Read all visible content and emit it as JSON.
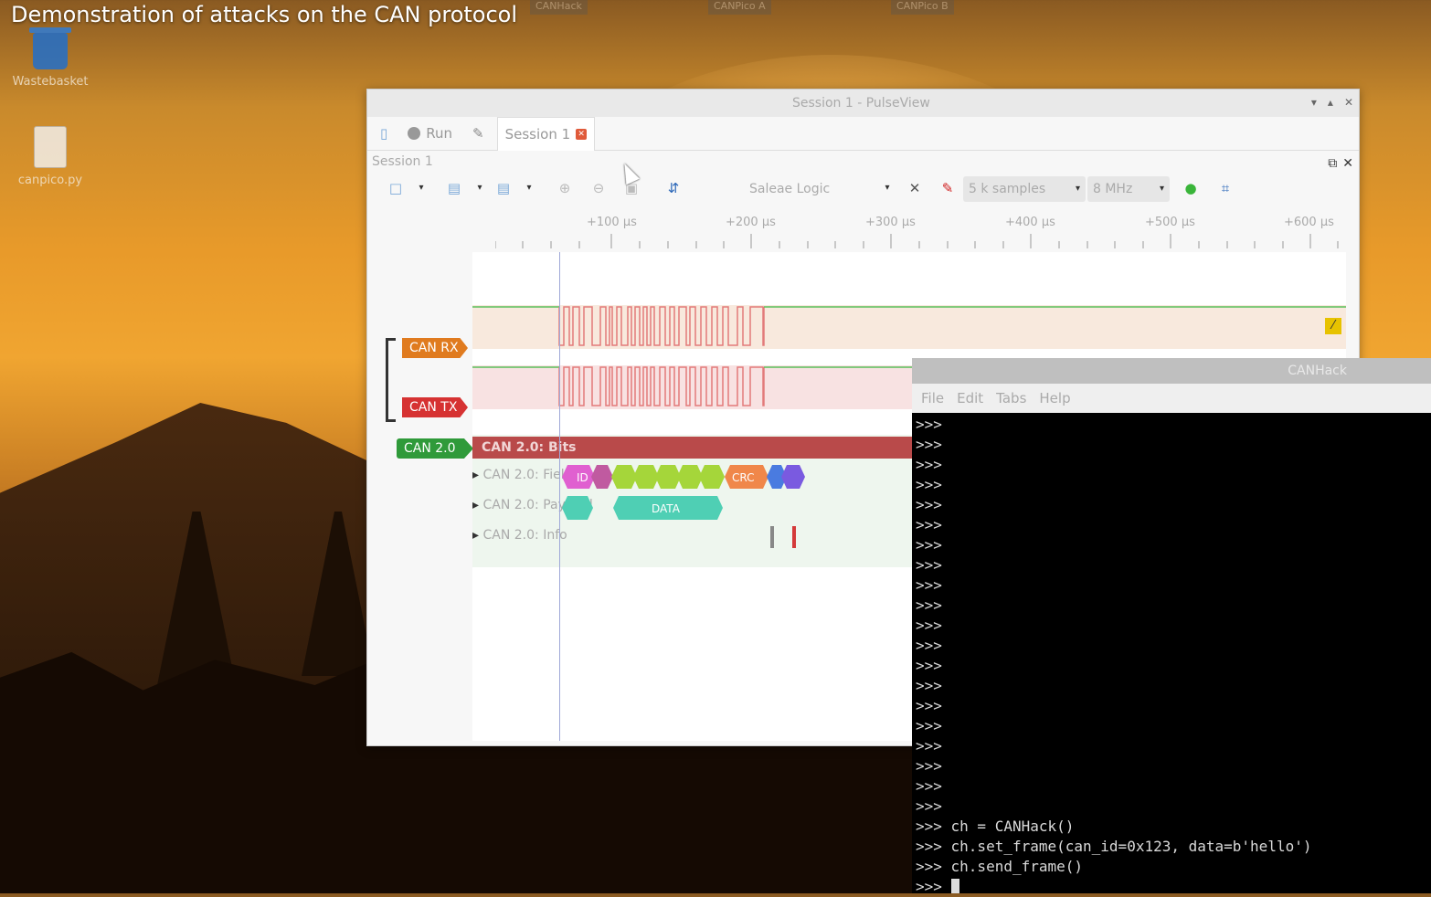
{
  "video_title": "Demonstration of attacks on the CAN protocol",
  "taskbar": {
    "items": [
      "CANHack",
      "CANPico A",
      "CANPico B"
    ]
  },
  "desktop_icons": [
    {
      "label": "Wastebasket"
    },
    {
      "label": "canpico.py"
    }
  ],
  "pulseview": {
    "window_title": "Session 1 - PulseView",
    "tabs": {
      "run_label": "Run",
      "session_tab_label": "Session 1"
    },
    "session_label": "Session 1",
    "toolbar": {
      "device_label": "Saleae Logic",
      "samples_value": "5 k samples",
      "rate_value": "8 MHz"
    },
    "ruler_labels": [
      "+100 µs",
      "+200 µs",
      "+300 µs",
      "+400 µs",
      "+500 µs",
      "+600 µs"
    ],
    "channels": {
      "rx": "CAN RX",
      "tx": "CAN TX",
      "decoder": "CAN 2.0"
    },
    "decoder_rows": {
      "bits": "CAN 2.0: Bits",
      "fields": "CAN 2.0: Fields",
      "payload": "CAN 2.0: Payload",
      "info": "CAN 2.0: Info"
    },
    "field_labels": {
      "crc": "CRC",
      "data": "DATA",
      "id": "ID"
    }
  },
  "terminal": {
    "window_title": "CANHack",
    "menu": [
      "File",
      "Edit",
      "Tabs",
      "Help"
    ],
    "prompt_lines": [
      ">>>",
      ">>>",
      ">>>",
      ">>>",
      ">>>",
      ">>>",
      ">>>",
      ">>>",
      ">>>",
      ">>>",
      ">>>",
      ">>>",
      ">>>",
      ">>>",
      ">>>",
      ">>>",
      ">>>",
      ">>>",
      ">>>",
      ">>>"
    ],
    "commands": [
      ">>> ch = CANHack()",
      ">>> ch.set_frame(can_id=0x123, data=b'hello')",
      ">>> ch.send_frame()"
    ],
    "current_prompt": ">>> "
  },
  "colors": {
    "rx_channel": "#e07b1f",
    "tx_channel": "#d63232",
    "decoder_channel": "#2f9a3a",
    "bits_bar": "#b94a4a",
    "fields_green": "#a5d63a",
    "payload_teal": "#4fcfb4"
  }
}
